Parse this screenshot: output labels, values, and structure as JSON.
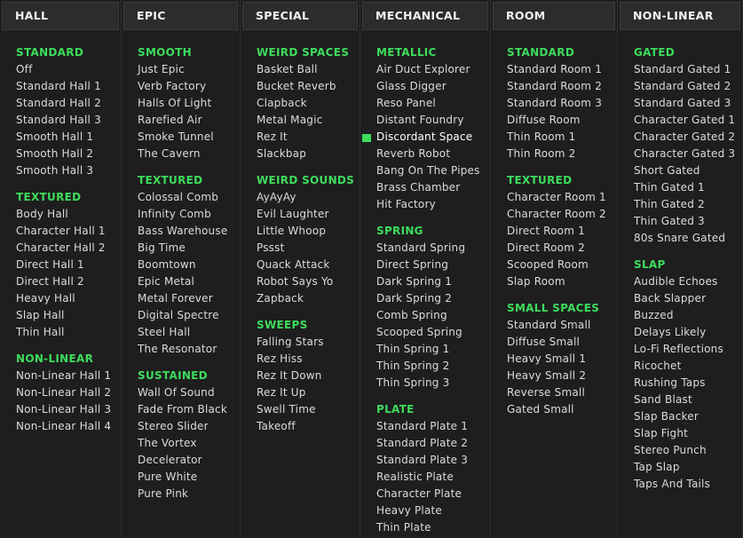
{
  "columns": [
    {
      "header": "HALL",
      "groups": [
        {
          "title": "STANDARD",
          "items": [
            "Off",
            "Standard Hall 1",
            "Standard Hall 2",
            "Standard Hall 3",
            "Smooth Hall 1",
            "Smooth Hall 2",
            "Smooth Hall 3"
          ]
        },
        {
          "title": "TEXTURED",
          "items": [
            "Body Hall",
            "Character Hall 1",
            "Character Hall 2",
            "Direct Hall 1",
            "Direct Hall 2",
            "Heavy Hall",
            "Slap Hall",
            "Thin Hall"
          ]
        },
        {
          "title": "NON-LINEAR",
          "items": [
            "Non-Linear Hall 1",
            "Non-Linear Hall 2",
            "Non-Linear Hall 3",
            "Non-Linear Hall 4"
          ]
        }
      ]
    },
    {
      "header": "EPIC",
      "groups": [
        {
          "title": "SMOOTH",
          "items": [
            "Just Epic",
            "Verb Factory",
            "Halls Of Light",
            "Rarefied Air",
            "Smoke Tunnel",
            "The Cavern"
          ]
        },
        {
          "title": "TEXTURED",
          "items": [
            "Colossal Comb",
            "Infinity Comb",
            "Bass Warehouse",
            "Big Time",
            "Boomtown",
            "Epic Metal",
            "Metal Forever",
            "Digital Spectre",
            "Steel Hall",
            "The Resonator"
          ]
        },
        {
          "title": "SUSTAINED",
          "items": [
            "Wall Of Sound",
            "Fade From Black",
            "Stereo Slider",
            "The Vortex",
            "Decelerator",
            "Pure White",
            "Pure Pink"
          ]
        }
      ]
    },
    {
      "header": "SPECIAL",
      "groups": [
        {
          "title": "WEIRD SPACES",
          "items": [
            "Basket Ball",
            "Bucket Reverb",
            "Clapback",
            "Metal Magic",
            "Rez It",
            "Slackbap"
          ]
        },
        {
          "title": "WEIRD SOUNDS",
          "items": [
            "AyAyAy",
            "Evil Laughter",
            "Little Whoop",
            "Pssst",
            "Quack Attack",
            "Robot Says Yo",
            "Zapback"
          ]
        },
        {
          "title": "SWEEPS",
          "items": [
            "Falling Stars",
            "Rez Hiss",
            "Rez It Down",
            "Rez It Up",
            "Swell Time",
            "Takeoff"
          ]
        }
      ]
    },
    {
      "header": "MECHANICAL",
      "groups": [
        {
          "title": "METALLIC",
          "items": [
            "Air Duct Explorer",
            "Glass Digger",
            "Reso Panel",
            "Distant Foundry",
            "Discordant Space",
            "Reverb Robot",
            "Bang On The Pipes",
            "Brass Chamber",
            "Hit Factory"
          ]
        },
        {
          "title": "SPRING",
          "items": [
            "Standard Spring",
            "Direct Spring",
            "Dark Spring 1",
            "Dark Spring 2",
            "Comb Spring",
            "Scooped Spring",
            "Thin Spring 1",
            "Thin Spring 2",
            "Thin Spring 3"
          ]
        },
        {
          "title": "PLATE",
          "items": [
            "Standard Plate 1",
            "Standard Plate 2",
            "Standard Plate 3",
            "Realistic Plate",
            "Character Plate",
            "Heavy Plate",
            "Thin Plate"
          ]
        }
      ]
    },
    {
      "header": "ROOM",
      "groups": [
        {
          "title": "STANDARD",
          "items": [
            "Standard Room 1",
            "Standard Room 2",
            "Standard Room 3",
            "Diffuse Room",
            "Thin Room 1",
            "Thin Room 2"
          ]
        },
        {
          "title": "TEXTURED",
          "items": [
            "Character Room 1",
            "Character Room 2",
            "Direct Room 1",
            "Direct Room 2",
            "Scooped Room",
            "Slap Room"
          ]
        },
        {
          "title": "SMALL SPACES",
          "items": [
            "Standard Small",
            "Diffuse Small",
            "Heavy Small 1",
            "Heavy Small 2",
            "Reverse Small",
            "Gated Small"
          ]
        }
      ]
    },
    {
      "header": "NON-LINEAR",
      "groups": [
        {
          "title": "GATED",
          "items": [
            "Standard Gated 1",
            "Standard Gated 2",
            "Standard Gated 3",
            "Character Gated 1",
            "Character Gated 2",
            "Character Gated 3",
            "Short Gated",
            "Thin Gated 1",
            "Thin Gated 2",
            "Thin Gated 3",
            "80s Snare Gated"
          ]
        },
        {
          "title": "SLAP",
          "items": [
            "Audible Echoes",
            "Back Slapper",
            "Buzzed",
            "Delays Likely",
            "Lo-Fi Reflections",
            "Ricochet",
            "Rushing Taps",
            "Sand Blast",
            "Slap Backer",
            "Slap Fight",
            "Stereo Punch",
            "Tap Slap",
            "Taps And Tails"
          ]
        }
      ]
    }
  ],
  "selected": "Discordant Space",
  "colors": {
    "accent": "#3ddc5c",
    "background": "#1e1e1e",
    "header": "#2c2c2c"
  }
}
